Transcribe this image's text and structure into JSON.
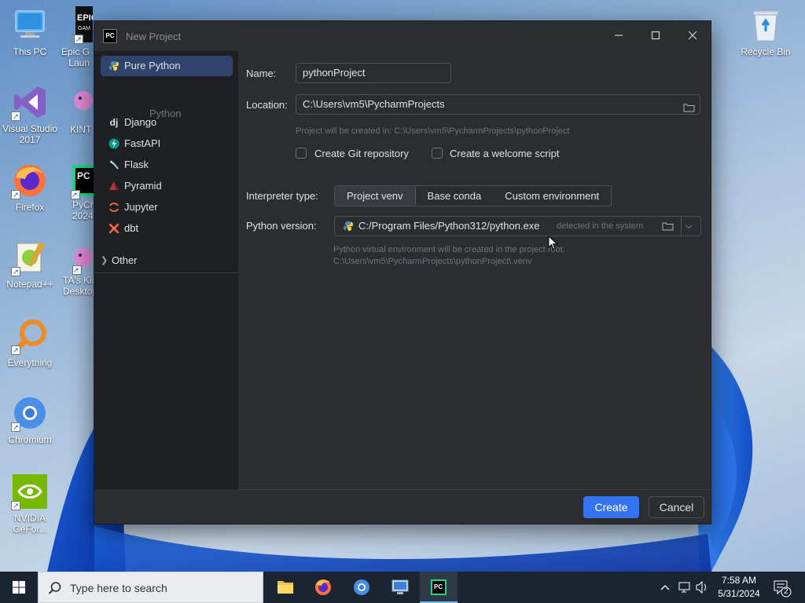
{
  "desktop": {
    "icons": [
      {
        "label": "This PC"
      },
      {
        "label": "Epic G\nLaun"
      },
      {
        "label": "Visual Studio\n2017"
      },
      {
        "label": "KINT"
      },
      {
        "label": "Firefox"
      },
      {
        "label": "PyCh\n2024"
      },
      {
        "label": "Notepad++"
      },
      {
        "label": "TA's Kin\nDesktop"
      },
      {
        "label": "Everything"
      },
      {
        "label": "Chromium"
      },
      {
        "label": "NVIDIA\nGeFor..."
      },
      {
        "label": "Recycle Bin"
      }
    ]
  },
  "dialog": {
    "title": "New Project",
    "app_logo": "PC",
    "sidebar": {
      "items": [
        {
          "label": "Pure Python",
          "icon": "python-icon"
        },
        {
          "label": "Django",
          "icon": "django-icon",
          "glyph": "dj"
        },
        {
          "label": "FastAPI",
          "icon": "fastapi-icon"
        },
        {
          "label": "Flask",
          "icon": "flask-icon"
        },
        {
          "label": "Pyramid",
          "icon": "pyramid-icon"
        },
        {
          "label": "Jupyter",
          "icon": "jupyter-icon"
        },
        {
          "label": "dbt",
          "icon": "dbt-icon"
        }
      ],
      "sublabel": "Python",
      "other": "Other"
    },
    "form": {
      "name_label": "Name:",
      "name_value": "pythonProject",
      "location_label": "Location:",
      "location_value": "C:\\Users\\vm5\\PycharmProjects",
      "location_hint": "Project will be created in: C:\\Users\\vm5\\PycharmProjects\\pythonProject",
      "git_label": "Create Git repository",
      "welcome_label": "Create a welcome script",
      "interpreter_label": "Interpreter type:",
      "interpreter_options": [
        "Project venv",
        "Base conda",
        "Custom environment"
      ],
      "interpreter_selected": "Project venv",
      "python_version_label": "Python version:",
      "python_path": "C:/Program Files/Python312/python.exe",
      "python_detected": "detected in the system",
      "venv_hint_1": "Python virtual environment will be created in the project root:",
      "venv_hint_2": "C:\\Users\\vm5\\PycharmProjects\\pythonProject\\.venv"
    },
    "buttons": {
      "create": "Create",
      "cancel": "Cancel"
    }
  },
  "taskbar": {
    "search_placeholder": "Type here to search",
    "time": "7:58 AM",
    "date": "5/31/2024",
    "notification_count": "2"
  },
  "colors": {
    "accent": "#3574f0",
    "selected_item": "#2e436e",
    "dialog_bg": "#2b2d30",
    "sidebar_bg": "#1f2023"
  }
}
